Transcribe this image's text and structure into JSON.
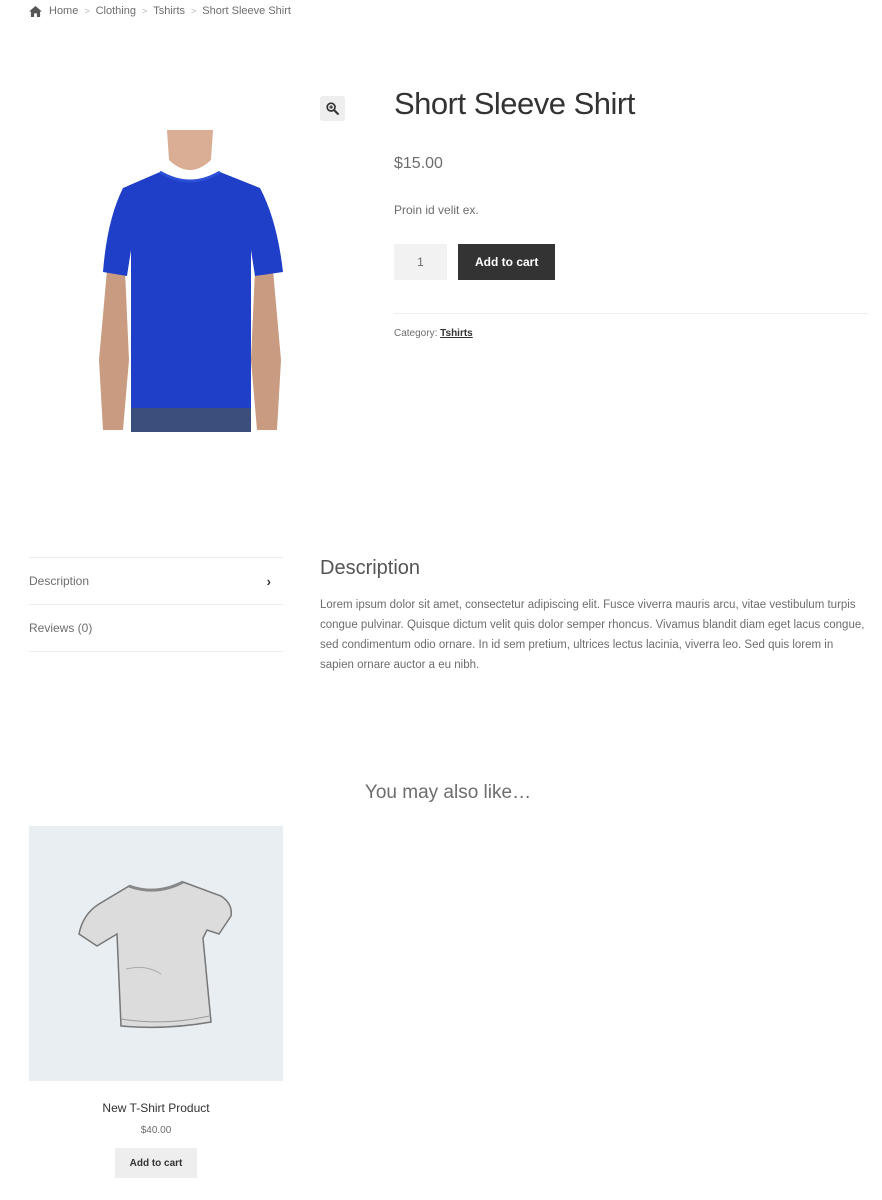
{
  "breadcrumb": {
    "home_icon": "home-icon",
    "items": [
      "Home",
      "Clothing",
      "Tshirts",
      "Short Sleeve Shirt"
    ],
    "separator": ">"
  },
  "gallery": {
    "zoom_icon": "magnifier-plus-icon",
    "image_description": "Man wearing blue short sleeve t-shirt",
    "shirt_color": "#1f3fc8"
  },
  "product": {
    "title": "Short Sleeve Shirt",
    "price": "$15.00",
    "short_description": "Proin id velit ex.",
    "quantity": "1",
    "add_to_cart_label": "Add to cart",
    "category_label": "Category:",
    "category_value": "Tshirts"
  },
  "tabs": [
    {
      "label": "Description",
      "active": true,
      "icon": "chevron-right-icon"
    },
    {
      "label": "Reviews (0)",
      "active": false
    }
  ],
  "description": {
    "heading": "Description",
    "text": "Lorem ipsum dolor sit amet, consectetur adipiscing elit. Fusce viverra mauris arcu, vitae vestibulum turpis congue pulvinar. Quisque dictum velit quis dolor semper rhoncus. Vivamus blandit diam eget lacus congue, sed condimentum odio ornare. In id sem pretium, ultrices lectus lacinia, viverra leo. Sed quis lorem in sapien ornare auctor a eu nibh."
  },
  "related": {
    "heading": "You may also like…",
    "products": [
      {
        "name": "New T-Shirt Product",
        "price": "$40.00",
        "button_label": "Add to cart",
        "image_description": "Grey t-shirt illustration"
      }
    ]
  },
  "colors": {
    "dark_button": "#333333",
    "light_button": "#eeeeee",
    "related_bg": "#e9eef3"
  }
}
